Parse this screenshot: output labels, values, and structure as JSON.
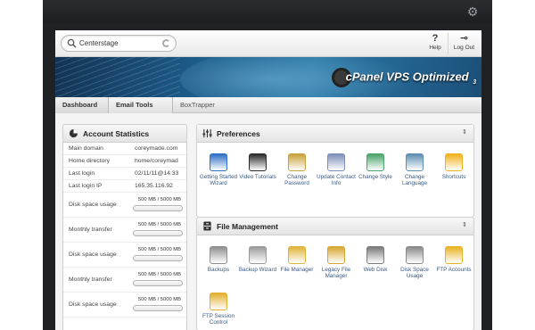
{
  "search": {
    "value": "Centerstage"
  },
  "topbar": {
    "help_label": "Help",
    "logout_label": "Log Out"
  },
  "branding": {
    "logo_main": "cPanel VPS Optimized",
    "logo_sub": "3"
  },
  "breadcrumb": [
    "Dashboard",
    "Email Tools",
    "BoxTrapper"
  ],
  "account_statistics": {
    "title": "Account Statistics",
    "rows": [
      {
        "label": "Main domain",
        "value": "coreymade.com"
      },
      {
        "label": "Home directory",
        "value": "home/coreymad"
      },
      {
        "label": "Last login",
        "value": "02/11/11@14:33"
      },
      {
        "label": "Last login IP",
        "value": "165.35.116.92"
      }
    ],
    "usage": [
      {
        "label": "Disk space usage",
        "amount": "500 MB / 5000 MB"
      },
      {
        "label": "Monthly transfer",
        "amount": "500 MB / 5000 MB"
      },
      {
        "label": "Disk space usage",
        "amount": "500 MB / 5000 MB"
      },
      {
        "label": "Monthly transfer",
        "amount": "500 MB / 5000 MB"
      },
      {
        "label": "Disk space usage",
        "amount": "500 MB / 5000 MB"
      }
    ]
  },
  "preferences": {
    "title": "Preferences",
    "items": [
      {
        "label": "Getting Started Wizard",
        "icon": "getting-started-wizard-icon",
        "color": "#2f6fc6"
      },
      {
        "label": "Video Tutorials",
        "icon": "video-tutorials-icon",
        "color": "#2b2b2b"
      },
      {
        "label": "Change Password",
        "icon": "change-password-icon",
        "color": "#c9a13a"
      },
      {
        "label": "Update Contact Info",
        "icon": "update-contact-info-icon",
        "color": "#7c8fb8"
      },
      {
        "label": "Change Style",
        "icon": "change-style-icon",
        "color": "#4aa36a"
      },
      {
        "label": "Change Language",
        "icon": "change-language-icon",
        "color": "#5d8fb1"
      },
      {
        "label": "Shortcuts",
        "icon": "shortcuts-icon",
        "color": "#f2b21b"
      }
    ]
  },
  "file_management": {
    "title": "File Management",
    "items": [
      {
        "label": "Backups",
        "icon": "backups-icon",
        "color": "#8f8f8f"
      },
      {
        "label": "Backup Wizard",
        "icon": "backup-wizard-icon",
        "color": "#9a9a9a"
      },
      {
        "label": "File Manager",
        "icon": "file-manager-icon",
        "color": "#e0b43a"
      },
      {
        "label": "Legacy File Manager",
        "icon": "legacy-file-manager-icon",
        "color": "#d9a631"
      },
      {
        "label": "Web Disk",
        "icon": "web-disk-icon",
        "color": "#7a7a7a"
      },
      {
        "label": "Disk Space Usage",
        "icon": "disk-space-usage-icon",
        "color": "#8a8a8a"
      },
      {
        "label": "FTP Accounts",
        "icon": "ftp-accounts-icon",
        "color": "#e8b323"
      },
      {
        "label": "FTP Session Control",
        "icon": "ftp-session-control-icon",
        "color": "#e2b02e"
      }
    ]
  }
}
